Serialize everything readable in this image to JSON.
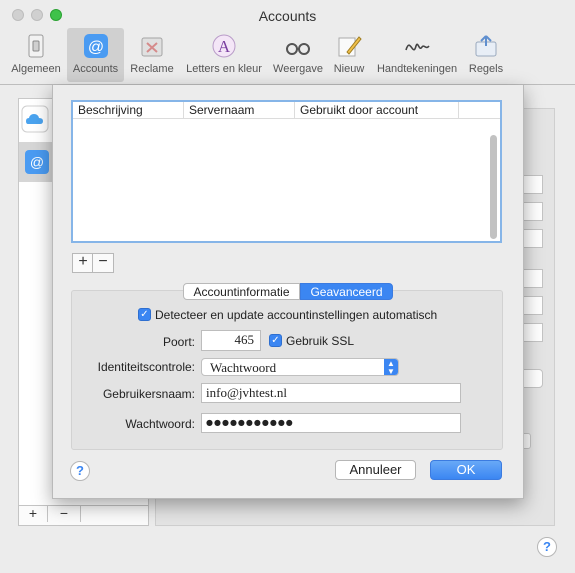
{
  "window": {
    "title": "Accounts"
  },
  "toolbar": {
    "items": [
      {
        "label": "Algemeen",
        "icon": "switch-icon"
      },
      {
        "label": "Accounts",
        "icon": "at-sign-icon",
        "active": true
      },
      {
        "label": "Reclame",
        "icon": "junk-bin-icon"
      },
      {
        "label": "Letters en kleur",
        "icon": "font-color-icon"
      },
      {
        "label": "Weergave",
        "icon": "glasses-icon"
      },
      {
        "label": "Nieuw",
        "icon": "pencil-icon"
      },
      {
        "label": "Handtekeningen",
        "icon": "signature-icon"
      },
      {
        "label": "Regels",
        "icon": "rules-icon"
      }
    ]
  },
  "sheet": {
    "table": {
      "columns": [
        "Beschrijving",
        "Servernaam",
        "Gebruikt door account"
      ]
    },
    "add_label": "+",
    "remove_label": "−",
    "tabs": {
      "info": "Accountinformatie",
      "advanced": "Geavanceerd"
    },
    "auto_detect_label": "Detecteer en update accountinstellingen automatisch",
    "port_label": "Poort:",
    "port_value": "465",
    "ssl_label": "Gebruik SSL",
    "auth_label": "Identiteitscontrole:",
    "auth_value": "Wachtwoord",
    "username_label": "Gebruikersnaam:",
    "username_value": "info@jvhtest.nl",
    "password_label": "Wachtwoord:",
    "password_value": "●●●●●●●●●●●",
    "help_label": "?",
    "cancel_label": "Annuleer",
    "ok_label": "OK"
  },
  "background": {
    "add_label": "+",
    "remove_label": "−",
    "help_label": "?"
  }
}
